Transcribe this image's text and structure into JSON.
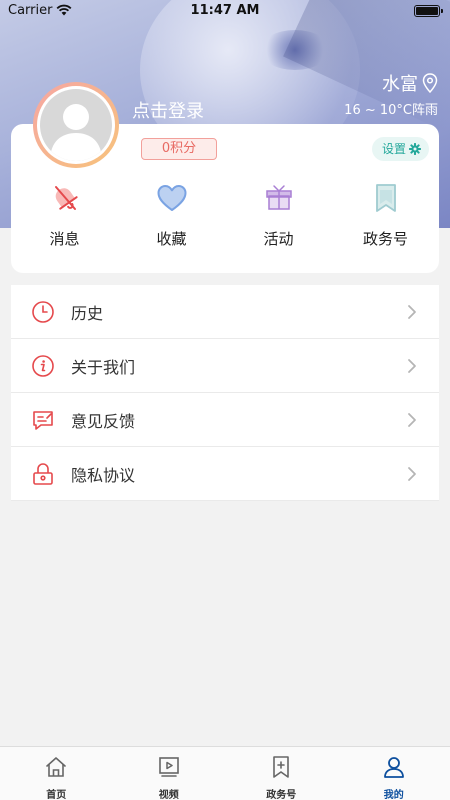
{
  "status_bar": {
    "carrier": "Carrier",
    "time": "11:47 AM"
  },
  "header": {
    "location": "水富",
    "weather": "16 ~ 10°C阵雨",
    "login_prompt": "点击登录"
  },
  "profile": {
    "points_badge": "0积分",
    "settings_label": "设置"
  },
  "quick_actions": [
    {
      "label": "消息",
      "icon": "bell-muted-icon"
    },
    {
      "label": "收藏",
      "icon": "heart-icon"
    },
    {
      "label": "活动",
      "icon": "gift-icon"
    },
    {
      "label": "政务号",
      "icon": "bookmark-icon"
    }
  ],
  "menu": [
    {
      "label": "历史",
      "icon": "clock-icon"
    },
    {
      "label": "关于我们",
      "icon": "info-icon"
    },
    {
      "label": "意见反馈",
      "icon": "feedback-icon"
    },
    {
      "label": "隐私协议",
      "icon": "lock-icon"
    }
  ],
  "tabs": [
    {
      "label": "首页",
      "icon": "home-icon",
      "active": false
    },
    {
      "label": "视频",
      "icon": "video-icon",
      "active": false
    },
    {
      "label": "政务号",
      "icon": "gov-bookmark-icon",
      "active": false
    },
    {
      "label": "我的",
      "icon": "user-icon",
      "active": true
    }
  ],
  "colors": {
    "accent_red": "#e5494c",
    "active_tab": "#0d4f9e",
    "settings_teal": "#24a89b"
  }
}
